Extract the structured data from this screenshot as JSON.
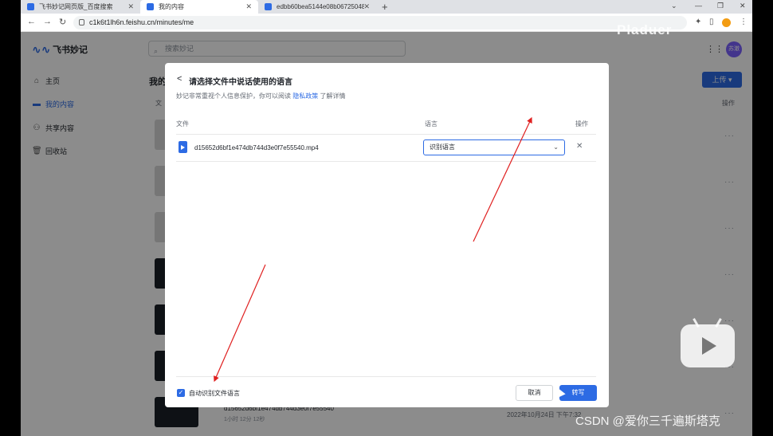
{
  "browser": {
    "tabs": [
      {
        "label": "飞书妙记网页版_百度搜索",
        "favicon_color": "#2d6be4"
      },
      {
        "label": "我的内容",
        "favicon_color": "#2d6be4"
      },
      {
        "label": "edbb60bea5144e08b06725048",
        "favicon_color": "#2d6be4"
      }
    ],
    "new_tab": "+",
    "url": "c1k6t1lh6n.feishu.cn/minutes/me"
  },
  "app": {
    "logo_text": "飞书妙记",
    "nav": [
      {
        "label": "主页",
        "icon": "home-icon",
        "glyph": "⌂"
      },
      {
        "label": "我的内容",
        "icon": "folder-icon",
        "glyph": "▬"
      },
      {
        "label": "共享内容",
        "icon": "people-icon",
        "glyph": "⚇"
      },
      {
        "label": "回收站",
        "icon": "trash-icon",
        "glyph": "🗑"
      }
    ],
    "search_placeholder": "搜索妙记",
    "avatar": "苏澈",
    "main_title": "我的",
    "upload": "上传 ▾",
    "col_file": "文",
    "col_op": "操作",
    "bottom_item": {
      "name": "d15652d6bf1e474db744d3e0f7e55540",
      "meta": "1小时 12分 12秒",
      "date": "2022年10月24日 下午7:32"
    }
  },
  "modal": {
    "back": "<",
    "title": "请选择文件中说话使用的语言",
    "subtitle_prefix": "妙记非常重视个人信息保护，你可以阅读",
    "subtitle_link": "隐私政策",
    "subtitle_suffix": "了解详情",
    "col_file": "文件",
    "col_lang": "语言",
    "col_op": "操作",
    "file_name": "d15652d6bf1e474db744d3e0f7e55540.mp4",
    "language_selected": "识别语言",
    "auto_detect": "自动识别文件语言",
    "cancel": "取消",
    "confirm": "转写"
  },
  "watermarks": {
    "top": "Pladuer",
    "bottom": "CSDN @爱你三千遍斯塔克"
  }
}
